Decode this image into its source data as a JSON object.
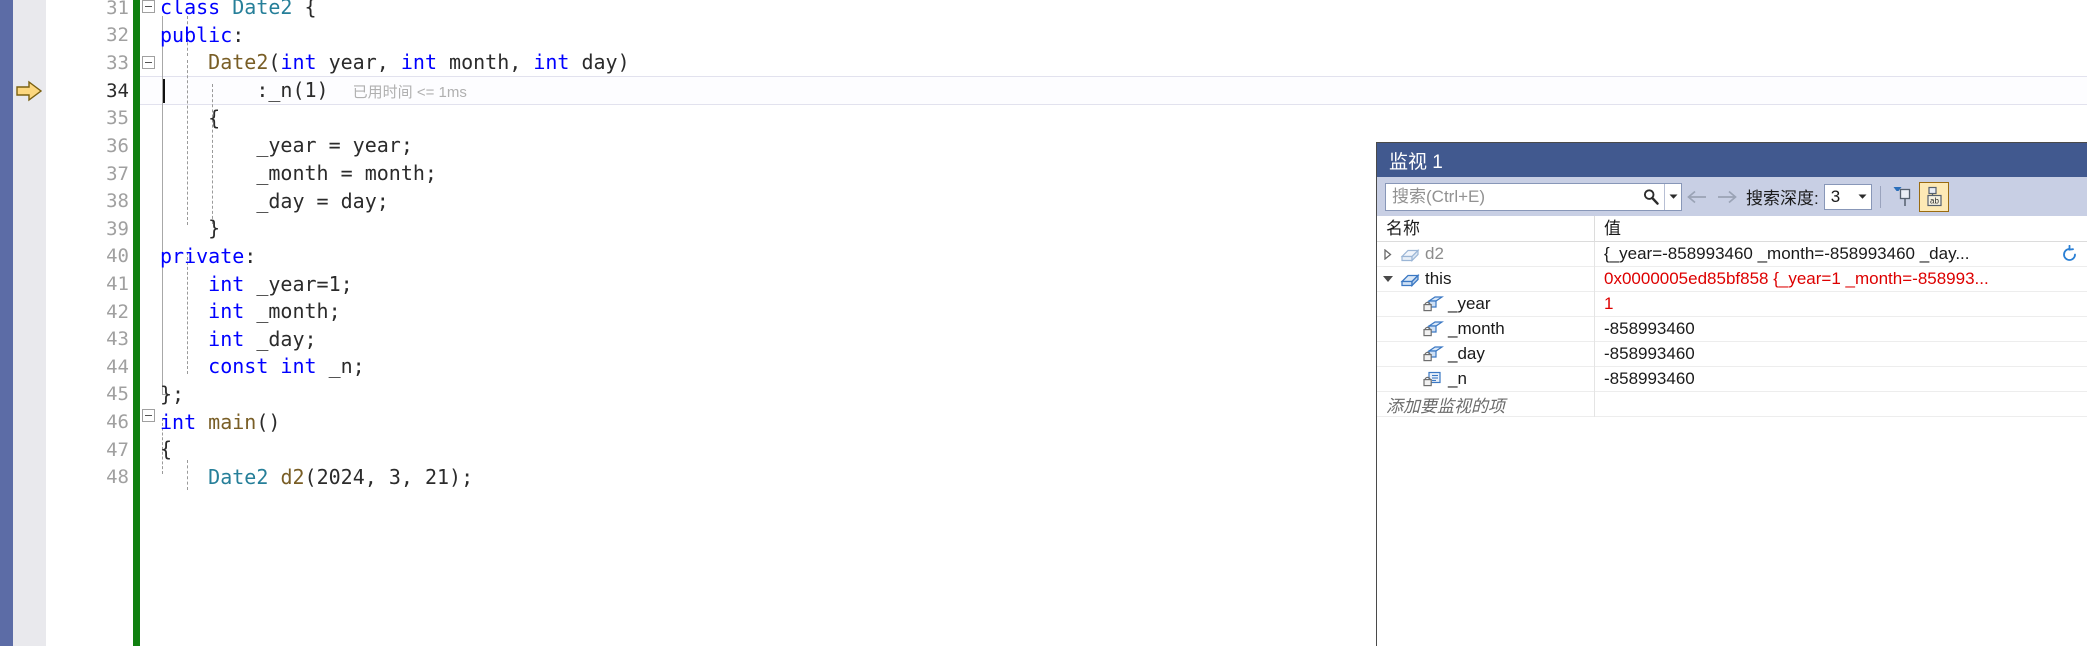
{
  "editor": {
    "language": "cpp",
    "current_line": 34,
    "current_statement_annotation": "已用时间 <= 1ms",
    "lines": [
      {
        "number": "31",
        "text": "class Date2 {"
      },
      {
        "number": "32",
        "text": "public:"
      },
      {
        "number": "33",
        "text": "    Date2(int year, int month, int day)"
      },
      {
        "number": "34",
        "text": "        :_n(1)"
      },
      {
        "number": "35",
        "text": "    {"
      },
      {
        "number": "36",
        "text": "        _year = year;"
      },
      {
        "number": "37",
        "text": "        _month = month;"
      },
      {
        "number": "38",
        "text": "        _day = day;"
      },
      {
        "number": "39",
        "text": "    }"
      },
      {
        "number": "40",
        "text": "private:"
      },
      {
        "number": "41",
        "text": "    int _year=1;"
      },
      {
        "number": "42",
        "text": "    int _month;"
      },
      {
        "number": "43",
        "text": "    int _day;"
      },
      {
        "number": "44",
        "text": "    const int _n;"
      },
      {
        "number": "45",
        "text": "};"
      },
      {
        "number": "46",
        "text": "int main()"
      },
      {
        "number": "47",
        "text": "{"
      },
      {
        "number": "48",
        "text": "    Date2 d2(2024, 3, 21);"
      }
    ]
  },
  "watch": {
    "title": "监视 1",
    "toolbar": {
      "search_placeholder": "搜索(Ctrl+E)",
      "search_value": "",
      "search_icon": "magnifier-icon",
      "dropdown_icon": "chevron-down-icon",
      "prev_icon": "arrow-left-icon",
      "next_icon": "arrow-right-icon",
      "depth_label": "搜索深度:",
      "depth_value": "3",
      "pin_filter_icon": "pin-filter-icon",
      "pin_ab_icon": "pin-ab-icon",
      "pin_ab_active": true
    },
    "columns": [
      "名称",
      "值"
    ],
    "rows": [
      {
        "name": "d2",
        "value": "{_year=-858993460 _month=-858993460 _day...",
        "icon": "object-box-icon",
        "expander": "collapsed",
        "indent": 0,
        "dim": true,
        "changed": false,
        "refresh": true
      },
      {
        "name": "this",
        "value": "0x0000005ed85bf858 {_year=1 _month=-858993...",
        "icon": "object-box-icon",
        "expander": "expanded",
        "indent": 0,
        "dim": false,
        "changed": true,
        "refresh": false
      },
      {
        "name": "_year",
        "value": "1",
        "icon": "private-field-icon",
        "expander": "none",
        "indent": 1,
        "dim": false,
        "changed": true,
        "refresh": false
      },
      {
        "name": "_month",
        "value": "-858993460",
        "icon": "private-field-icon",
        "expander": "none",
        "indent": 1,
        "dim": false,
        "changed": false,
        "refresh": false
      },
      {
        "name": "_day",
        "value": "-858993460",
        "icon": "private-field-icon",
        "expander": "none",
        "indent": 1,
        "dim": false,
        "changed": false,
        "refresh": false
      },
      {
        "name": "_n",
        "value": "-858993460",
        "icon": "private-constant-icon",
        "expander": "none",
        "indent": 1,
        "dim": false,
        "changed": false,
        "refresh": false
      }
    ],
    "add_placeholder": "添加要监视的项"
  },
  "colors": {
    "keyword": "#0000ff",
    "type": "#267f99",
    "function": "#795e26",
    "plain": "#2b2b2b",
    "changed_value": "#dd0000",
    "title_bar": "#41598f",
    "toolbar_bg": "#c8cfe4",
    "change_bar": "#108010",
    "selection_strip": "#5c6ca6",
    "indicator_margin": "#e9e9ed"
  }
}
